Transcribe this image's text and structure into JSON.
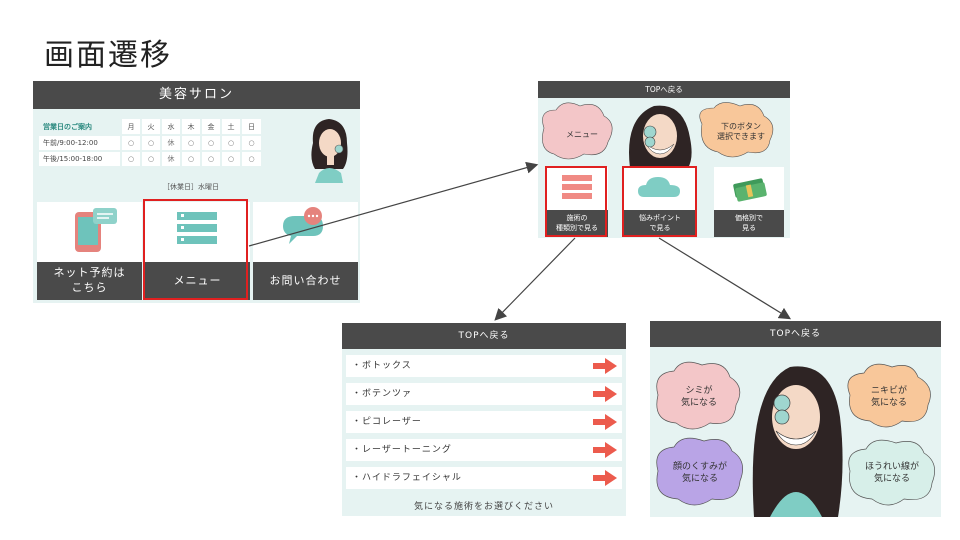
{
  "page": {
    "title": "画面遷移"
  },
  "salon_top": {
    "header": "美容サロン",
    "hours_title": "営業日のご案内",
    "days": [
      "月",
      "火",
      "水",
      "木",
      "金",
      "土",
      "日"
    ],
    "rows": [
      {
        "label": "午前/9:00-12:00",
        "cells": [
          "○",
          "○",
          "休",
          "○",
          "○",
          "○",
          "○"
        ]
      },
      {
        "label": "午後/15:00-18:00",
        "cells": [
          "○",
          "○",
          "休",
          "○",
          "○",
          "○",
          "○"
        ]
      }
    ],
    "closed_note": "［休業日］水曜日",
    "tiles": [
      {
        "label": "ネット予約は\nこちら",
        "icon": "smartphone-icon"
      },
      {
        "label": "メニュー",
        "icon": "menu-list-icon"
      },
      {
        "label": "お問い合わせ",
        "icon": "chat-bubble-icon"
      }
    ]
  },
  "menu_hub": {
    "header": "TOPへ戻る",
    "cloud_left": "メニュー",
    "cloud_right": "下のボタン\n選択できます",
    "tiles": [
      {
        "label": "施術の\n種類別で見る",
        "icon": "list-icon"
      },
      {
        "label": "悩みポイント\nで見る",
        "icon": "cloud-icon"
      },
      {
        "label": "価格別で\n見る",
        "icon": "money-icon"
      }
    ]
  },
  "treatment_list": {
    "header": "TOPへ戻る",
    "items": [
      "・ボトックス",
      "・ボテンツァ",
      "・ピコレーザー",
      "・レーザートーニング",
      "・ハイドラフェイシャル"
    ],
    "footer": "気になる施術をお選びください"
  },
  "concern_screen": {
    "header": "TOPへ戻る",
    "clouds": [
      "シミが\n気になる",
      "ニキビが\n気になる",
      "顔のくすみが\n気になる",
      "ほうれい線が\n気になる"
    ]
  },
  "colors": {
    "header": "#4a4a4a",
    "panel": "#e6f3f2",
    "highlight": "#e02020",
    "teal": "#5fb8b0",
    "pink": "#f3c6c8",
    "orange": "#f8c79a",
    "purple": "#b9a4e6"
  }
}
